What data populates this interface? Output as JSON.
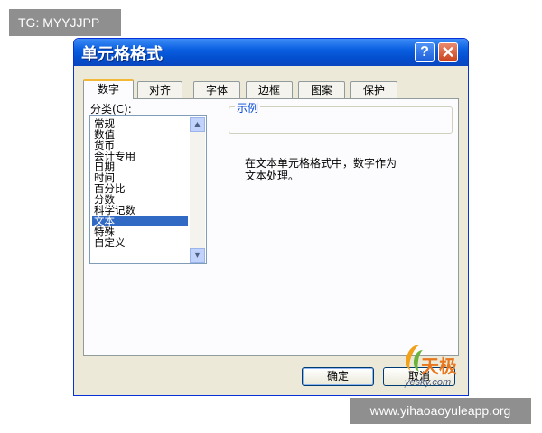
{
  "badge": {
    "text": "TG: MYYJJPP"
  },
  "dialog": {
    "title": "单元格格式",
    "help_glyph": "?",
    "close_glyph": "✕",
    "tabs": [
      {
        "label": "数字",
        "active": true
      },
      {
        "label": "对齐",
        "active": false
      },
      {
        "label": "字体",
        "active": false
      },
      {
        "label": "边框",
        "active": false
      },
      {
        "label": "图案",
        "active": false
      },
      {
        "label": "保护",
        "active": false
      }
    ],
    "category_label": "分类(C):",
    "categories": [
      "常规",
      "数值",
      "货币",
      "会计专用",
      "日期",
      "时间",
      "百分比",
      "分数",
      "科学记数",
      "文本",
      "特殊",
      "自定义"
    ],
    "selected_category": "文本",
    "sample_label": "示例",
    "description_line1": "在文本单元格格式中，数字作为",
    "description_line2": "文本处理。",
    "ok_label": "确定",
    "cancel_label": "取消"
  },
  "watermark": {
    "text_cn": "天极",
    "text_en": "yesky.com"
  },
  "url_badge": {
    "text": "www.yihaoaoyuleapp.org"
  },
  "colors": {
    "title_bar": "#0a5fe0",
    "selection": "#316ac5",
    "dialog_bg": "#ece9d8"
  }
}
